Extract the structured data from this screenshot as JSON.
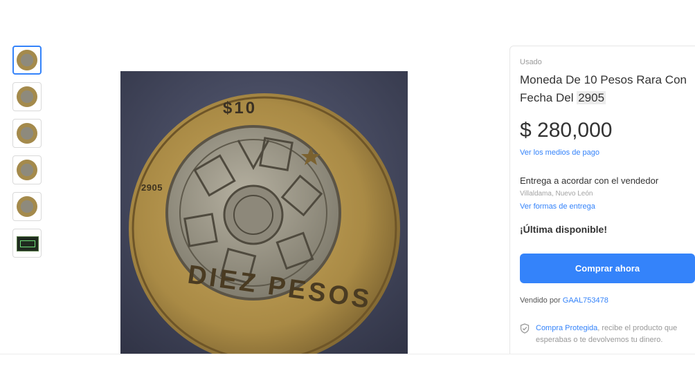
{
  "thumbnails": [
    {
      "kind": "coin",
      "selected": true
    },
    {
      "kind": "coin",
      "selected": false
    },
    {
      "kind": "coin",
      "selected": false
    },
    {
      "kind": "coin",
      "selected": false
    },
    {
      "kind": "coin",
      "selected": false
    },
    {
      "kind": "tag",
      "selected": false
    }
  ],
  "coin_image": {
    "denomination": "$10",
    "date": "2905",
    "name": "DIEZ PESOS"
  },
  "product": {
    "condition": "Usado",
    "title_prefix": "Moneda De 10 Pesos Rara Con Fecha Del ",
    "title_highlight": "2905",
    "price": "$ 280,000",
    "payment_link": "Ver los medios de pago",
    "delivery": "Entrega a acordar con el vendedor",
    "location": "Villaldama, Nuevo León",
    "shipping_link": "Ver formas de entrega",
    "stock": "¡Última disponible!",
    "buy_label": "Comprar ahora",
    "seller_prefix": "Vendido por ",
    "seller_name": "GAAL753478",
    "protect_link": "Compra Protegida",
    "protect_text": ", recibe el producto que esperabas o te devolvemos tu dinero."
  },
  "colors": {
    "accent": "#3483fa",
    "text": "#333333",
    "muted": "#999999"
  }
}
